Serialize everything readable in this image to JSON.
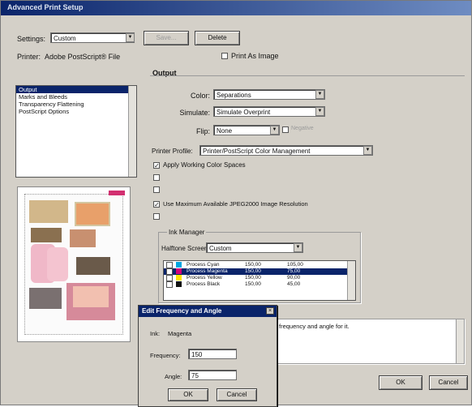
{
  "window": {
    "title": "Advanced Print Setup"
  },
  "top": {
    "settings_label": "Settings:",
    "settings_value": "Custom",
    "save_label": "Save...",
    "delete_label": "Delete",
    "printer_label": "Printer:",
    "printer_value": "Adobe PostScript® File",
    "print_as_image_label": "Print As Image"
  },
  "categories": {
    "items": [
      "Output",
      "Marks and Bleeds",
      "Transparency Flattening",
      "PostScript Options"
    ],
    "selected_index": 0
  },
  "output": {
    "section_title": "Output",
    "color_label": "Color:",
    "color_value": "Separations",
    "simulate_label": "Simulate:",
    "simulate_value": "Simulate Overprint",
    "flip_label": "Flip:",
    "flip_value": "None",
    "negative_label": "Negative",
    "profile_label": "Printer Profile:",
    "profile_value": "Printer/PostScript Color Management",
    "apply_working_label": "Apply Working Color Spaces",
    "max_resolution_label": "Use Maximum Available JPEG2000 Image Resolution",
    "ink_manager_label": "Ink Manager",
    "halftone_label": "Halftone Screen:",
    "halftone_value": "Custom"
  },
  "inks": {
    "rows": [
      {
        "name": "Process Cyan",
        "frequency": "150,00",
        "angle": "105,00",
        "color": "#00a5e0",
        "selected": false
      },
      {
        "name": "Process Magenta",
        "frequency": "150,00",
        "angle": "75,00",
        "color": "#d4007a",
        "selected": true
      },
      {
        "name": "Process Yellow",
        "frequency": "150,00",
        "angle": "90,00",
        "color": "#ffe400",
        "selected": false
      },
      {
        "name": "Process Black",
        "frequency": "150,00",
        "angle": "45,00",
        "color": "#111111",
        "selected": false
      }
    ]
  },
  "description": {
    "text": "frequency and angle for it."
  },
  "footer": {
    "ok_label": "OK",
    "cancel_label": "Cancel"
  },
  "dialog": {
    "title": "Edit Frequency and Angle",
    "ink_label": "Ink:",
    "ink_value": "Magenta",
    "frequency_label": "Frequency:",
    "frequency_value": "150",
    "angle_label": "Angle:",
    "angle_value": "75",
    "ok_label": "OK",
    "cancel_label": "Cancel"
  },
  "colors": {
    "title_bar": "#0a246a",
    "face": "#d4d0c8",
    "selection": "#0a246a"
  }
}
